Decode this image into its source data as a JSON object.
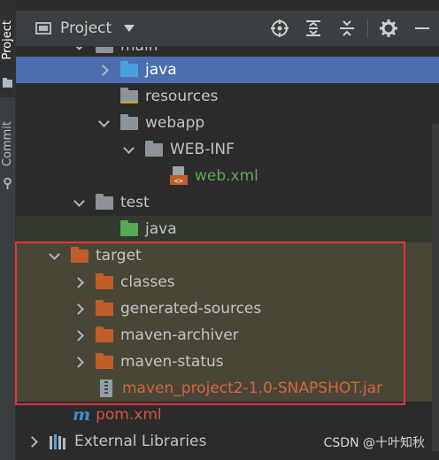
{
  "sidebar": {
    "project_label": "Project",
    "commit_label": "Commit"
  },
  "header": {
    "title": "Project",
    "tools": [
      "locate-icon",
      "expand-all-icon",
      "collapse-all-icon",
      "gear-icon",
      "minimize-icon"
    ]
  },
  "tree": {
    "rows": [
      {
        "label": "main",
        "state": "expanded"
      },
      {
        "label": "java",
        "state": "collapsed",
        "selected": true
      },
      {
        "label": "resources"
      },
      {
        "label": "webapp",
        "state": "expanded"
      },
      {
        "label": "WEB-INF",
        "state": "expanded"
      },
      {
        "label": "web.xml"
      },
      {
        "label": "test",
        "state": "expanded"
      },
      {
        "label": "java"
      },
      {
        "label": "target",
        "state": "expanded"
      },
      {
        "label": "classes",
        "state": "collapsed"
      },
      {
        "label": "generated-sources",
        "state": "collapsed"
      },
      {
        "label": "maven-archiver",
        "state": "collapsed"
      },
      {
        "label": "maven-status",
        "state": "collapsed"
      },
      {
        "label": "maven_project2-1.0-SNAPSHOT.jar"
      },
      {
        "label": "pom.xml"
      },
      {
        "label": "External Libraries",
        "state": "collapsed"
      }
    ]
  },
  "watermark": "CSDN @十叶知秋",
  "colors": {
    "selection": "#4b6eaf",
    "highlight_box": "#e0353d",
    "excluded_folder": "#c05d2a",
    "source_folder": "#4b9fdc",
    "test_folder": "#54a857"
  }
}
